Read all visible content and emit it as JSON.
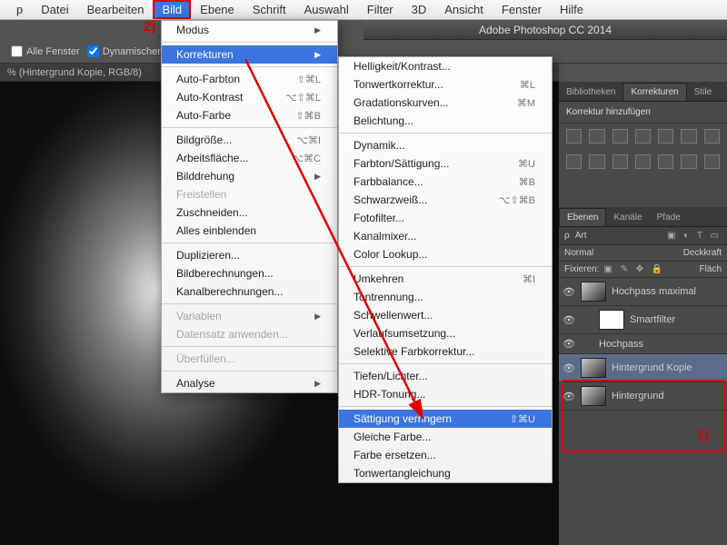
{
  "menubar": [
    "p",
    "Datei",
    "Bearbeiten",
    "Bild",
    "Ebene",
    "Schrift",
    "Auswahl",
    "Filter",
    "3D",
    "Ansicht",
    "Fenster",
    "Hilfe"
  ],
  "menubar_active_index": 3,
  "app_title": "Adobe Photoshop CC 2014",
  "annotations": {
    "step1": "1)",
    "step2": "2)"
  },
  "options": {
    "all_windows": "Alle Fenster",
    "dynamic": "Dynamischer"
  },
  "doc_tab": "% (Hintergrund Kopie, RGB/8)",
  "dd1": {
    "groups": [
      [
        {
          "label": "Modus",
          "arrow": true
        }
      ],
      [
        {
          "label": "Korrekturen",
          "arrow": true,
          "hover": true
        }
      ],
      [
        {
          "label": "Auto-Farbton",
          "shortcut": "⇧⌘L"
        },
        {
          "label": "Auto-Kontrast",
          "shortcut": "⌥⇧⌘L"
        },
        {
          "label": "Auto-Farbe",
          "shortcut": "⇧⌘B"
        }
      ],
      [
        {
          "label": "Bildgröße...",
          "shortcut": "⌥⌘I"
        },
        {
          "label": "Arbeitsfläche...",
          "shortcut": "⌥⌘C"
        },
        {
          "label": "Bilddrehung",
          "arrow": true
        },
        {
          "label": "Freistellen",
          "disabled": true
        },
        {
          "label": "Zuschneiden..."
        },
        {
          "label": "Alles einblenden"
        }
      ],
      [
        {
          "label": "Duplizieren..."
        },
        {
          "label": "Bildberechnungen..."
        },
        {
          "label": "Kanalberechnungen..."
        }
      ],
      [
        {
          "label": "Variablen",
          "arrow": true,
          "disabled": true
        },
        {
          "label": "Datensatz anwenden...",
          "disabled": true
        }
      ],
      [
        {
          "label": "Überfüllen...",
          "disabled": true
        }
      ],
      [
        {
          "label": "Analyse",
          "arrow": true
        }
      ]
    ]
  },
  "dd2": {
    "groups": [
      [
        {
          "label": "Helligkeit/Kontrast..."
        },
        {
          "label": "Tonwertkorrektur...",
          "shortcut": "⌘L"
        },
        {
          "label": "Gradationskurven...",
          "shortcut": "⌘M"
        },
        {
          "label": "Belichtung..."
        }
      ],
      [
        {
          "label": "Dynamik..."
        },
        {
          "label": "Farbton/Sättigung...",
          "shortcut": "⌘U"
        },
        {
          "label": "Farbbalance...",
          "shortcut": "⌘B"
        },
        {
          "label": "Schwarzweiß...",
          "shortcut": "⌥⇧⌘B"
        },
        {
          "label": "Fotofilter..."
        },
        {
          "label": "Kanalmixer..."
        },
        {
          "label": "Color Lookup..."
        }
      ],
      [
        {
          "label": "Umkehren",
          "shortcut": "⌘I"
        },
        {
          "label": "Tontrennung..."
        },
        {
          "label": "Schwellenwert..."
        },
        {
          "label": "Verlaufsumsetzung..."
        },
        {
          "label": "Selektive Farbkorrektur..."
        }
      ],
      [
        {
          "label": "Tiefen/Lichter..."
        },
        {
          "label": "HDR-Tonung..."
        }
      ],
      [
        {
          "label": "Sättigung verringern",
          "shortcut": "⇧⌘U",
          "hover": true
        },
        {
          "label": "Gleiche Farbe..."
        },
        {
          "label": "Farbe ersetzen..."
        },
        {
          "label": "Tonwertangleichung"
        }
      ]
    ]
  },
  "right_panel": {
    "tabs_top": [
      "Bibliotheken",
      "Korrekturen",
      "Stile"
    ],
    "tabs_top_active": 1,
    "add_label": "Korrektur hinzufügen",
    "layer_tabs": [
      "Ebenen",
      "Kanäle",
      "Pfade"
    ],
    "layer_tabs_active": 0,
    "filter_label": "Art",
    "blend_mode": "Normal",
    "opacity_label": "Deckkraft",
    "fix_label": "Fixieren:",
    "fill_label": "Fläch",
    "layers": [
      {
        "name": "Hochpass maximal",
        "eye": true,
        "thumb": "dark"
      },
      {
        "name": "Smartfilter",
        "eye": true,
        "thumb": "white",
        "indent": true
      },
      {
        "name": "Hochpass",
        "eye": true,
        "indent": true,
        "nothumb": true
      },
      {
        "name": "Hintergrund Kopie",
        "eye": true,
        "thumb": "dark",
        "sel": true
      },
      {
        "name": "Hintergrund",
        "eye": true,
        "thumb": "dark"
      }
    ]
  }
}
